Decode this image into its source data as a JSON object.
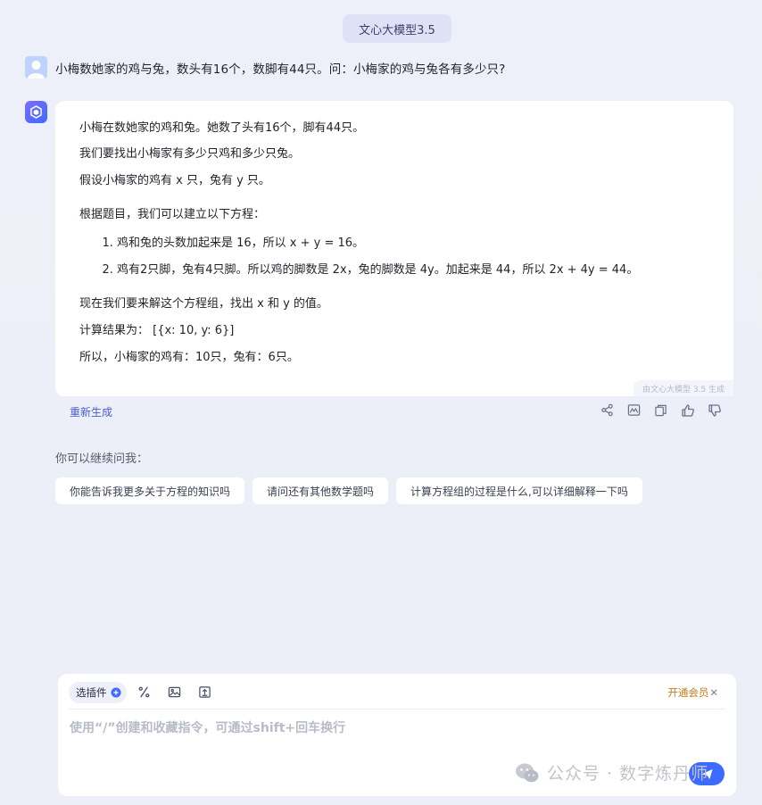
{
  "header": {
    "model_name": "文心大模型3.5"
  },
  "user_message": {
    "text": "小梅数她家的鸡与兔，数头有16个，数脚有44只。问：小梅家的鸡与兔各有多少只?"
  },
  "answer": {
    "para1": "小梅在数她家的鸡和兔。她数了头有16个，脚有44只。",
    "para2": "我们要找出小梅家有多少只鸡和多少只兔。",
    "para3": "假设小梅家的鸡有 x 只，兔有 y 只。",
    "para4": "根据题目，我们可以建立以下方程：",
    "list": [
      "鸡和兔的头数加起来是 16，所以 x + y = 16。",
      "鸡有2只脚，兔有4只脚。所以鸡的脚数是 2x，兔的脚数是 4y。加起来是 44，所以 2x + 4y = 44。"
    ],
    "para5": "现在我们要来解这个方程组，找出 x 和 y 的值。",
    "para6": "计算结果为：  [{x: 10, y: 6}]",
    "para7": "所以，小梅家的鸡有：10只，兔有：6只。",
    "generated_tag": "由文心大模型 3.5 生成"
  },
  "actions": {
    "regenerate_label": "重新生成"
  },
  "suggestions": {
    "label": "你可以继续问我：",
    "chips": [
      "你能告诉我更多关于方程的知识吗",
      "请问还有其他数学题吗",
      "计算方程组的过程是什么,可以详细解释一下吗"
    ]
  },
  "input": {
    "plugin_label": "选插件",
    "vip_label": "开通会员",
    "placeholder": "使用“/”创建和收藏指令，可通过shift+回车换行"
  },
  "watermark": {
    "text": "公众号 · 数字炼丹师"
  }
}
